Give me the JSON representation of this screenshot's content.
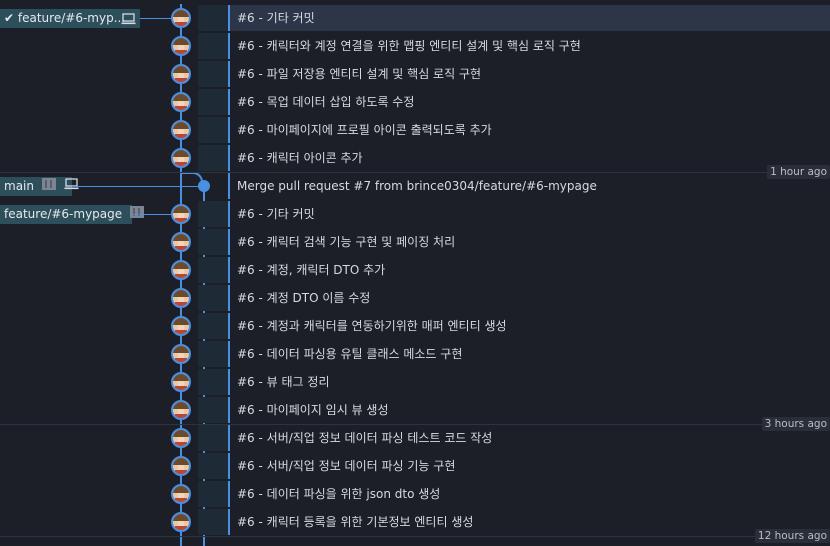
{
  "branches": {
    "feature_local": {
      "label": "feature/#6-myp...",
      "check": "✔",
      "icon": "laptop-icon"
    },
    "main": {
      "label": "main",
      "icons": [
        "remote-icon",
        "laptop-icon"
      ]
    },
    "feature_remote": {
      "label": "feature/#6-mypage",
      "icon": "remote-icon"
    }
  },
  "time_ticks": [
    "1 hour ago",
    "3 hours ago",
    "12 hours ago"
  ],
  "commits": [
    {
      "message": "#6 - 기타 커밋",
      "selected": true
    },
    {
      "message": "#6 - 캐릭터와 계정 연결을 위한 맵핑 엔티티 설계 및 핵심 로직 구현"
    },
    {
      "message": "#6 - 파일 저장용 엔티티 설계 및 핵심 로직 구현"
    },
    {
      "message": "#6 - 목업 데이터 삽입 하도록 수정"
    },
    {
      "message": "#6 - 마이페이지에 프로필 아이콘 출력되도록 추가"
    },
    {
      "message": "#6 - 캐릭터 아이콘 추가"
    },
    {
      "message": "Merge pull request #7 from brince0304/feature/#6-mypage",
      "merge": true
    },
    {
      "message": "#6 - 기타 커밋"
    },
    {
      "message": "#6 - 캐릭터 검색 기능 구현 및 페이징 처리"
    },
    {
      "message": "#6 - 계정, 캐릭터 DTO 추가"
    },
    {
      "message": "#6 - 계정 DTO 이름 수정"
    },
    {
      "message": "#6 - 계정과 캐릭터를 연동하기위한 매퍼 엔티티 생성"
    },
    {
      "message": "#6 - 데이터 파싱용 유틸 클래스 메소드 구현"
    },
    {
      "message": "#6 - 뷰 태그 정리"
    },
    {
      "message": "#6 - 마이페이지 임시 뷰 생성"
    },
    {
      "message": "#6 - 서버/직업 정보 데이터 파싱 테스트 코드 작성"
    },
    {
      "message": "#6 - 서버/직업 정보 데이터 파싱 기능 구현"
    },
    {
      "message": "#6 - 데이터 파싱을 위한 json dto 생성"
    },
    {
      "message": "#6 - 캐릭터 등록을 위한 기본정보 엔티티 생성"
    }
  ],
  "colors": {
    "background": "#1c1f27",
    "lane": "#4a90e2",
    "selected_row": "#2c3648",
    "branch_tag": "#2d4f5c"
  }
}
